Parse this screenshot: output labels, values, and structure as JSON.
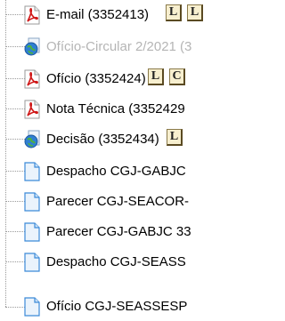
{
  "tree": {
    "items": [
      {
        "label": "E-mail (3352413)",
        "icon": "pdf-icon",
        "buttons": [
          "L",
          "L"
        ]
      },
      {
        "label": "Ofício-Circular 2/2021 (3",
        "icon": "globe-document-icon",
        "disabled": true
      },
      {
        "label": "Ofício (3352424)",
        "icon": "pdf-icon",
        "buttons": [
          "L",
          "C"
        ]
      },
      {
        "label": "Nota Técnica (3352429",
        "icon": "pdf-icon"
      },
      {
        "label": "Decisão (3352434)",
        "icon": "globe-document-icon",
        "buttons": [
          "L"
        ]
      },
      {
        "label": "Despacho CGJ-GABJC",
        "icon": "document-icon"
      },
      {
        "label": "Parecer CGJ-SEACOR-",
        "icon": "document-icon"
      },
      {
        "label": "Parecer CGJ-GABJC 33",
        "icon": "document-icon"
      },
      {
        "label": "Despacho CGJ-SEASS",
        "icon": "document-icon"
      },
      {
        "label": "Ofício CGJ-SEASSESP",
        "icon": "document-icon"
      }
    ]
  }
}
